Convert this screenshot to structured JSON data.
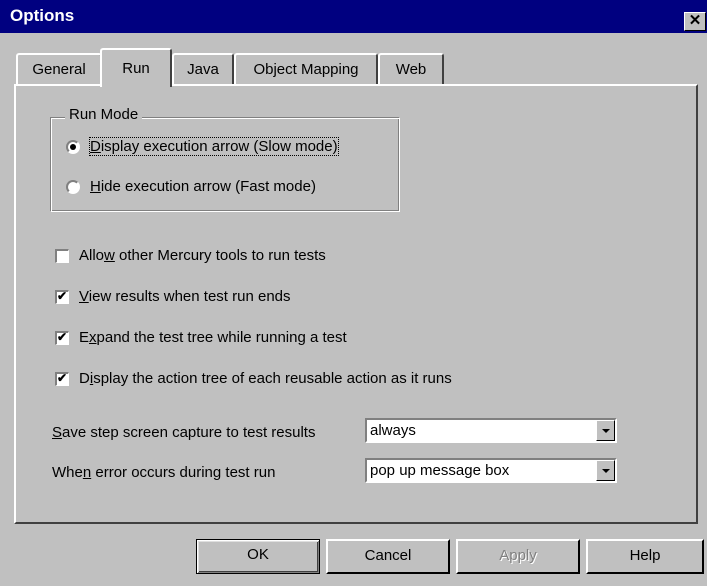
{
  "window": {
    "title": "Options",
    "close_glyph": "✕"
  },
  "tabs": [
    {
      "label": "General",
      "active": false
    },
    {
      "label": "Run",
      "active": true
    },
    {
      "label": "Java",
      "active": false
    },
    {
      "label": "Object Mapping",
      "active": false
    },
    {
      "label": "Web",
      "active": false
    }
  ],
  "run_mode": {
    "group_label": "Run Mode",
    "options": [
      {
        "label_mnemonic": "D",
        "label_rest": "isplay execution arrow (Slow mode)",
        "selected": true
      },
      {
        "label_mnemonic": "H",
        "label_rest": "ide execution arrow (Fast mode)",
        "selected": false
      }
    ]
  },
  "checkboxes": [
    {
      "pre": "Allo",
      "mnemonic": "w",
      "post": " other Mercury tools to run tests",
      "checked": false
    },
    {
      "pre": "",
      "mnemonic": "V",
      "post": "iew results when test run ends",
      "checked": true
    },
    {
      "pre": "E",
      "mnemonic": "x",
      "post": "pand the test tree while running a test",
      "checked": true
    },
    {
      "pre": "D",
      "mnemonic": "i",
      "post": "splay the action tree of each reusable action as it runs",
      "checked": true
    }
  ],
  "fields": {
    "save_capture": {
      "pre": "",
      "mnemonic": "S",
      "post": "ave step screen capture to test results",
      "value": "always"
    },
    "on_error": {
      "pre": "Whe",
      "mnemonic": "n",
      "post": " error occurs during test run",
      "value": "pop up message box"
    }
  },
  "buttons": {
    "ok": "OK",
    "cancel": "Cancel",
    "apply": "Apply",
    "help": "Help"
  },
  "colors": {
    "title_bar": "#000080",
    "face": "#c0c0c0"
  }
}
